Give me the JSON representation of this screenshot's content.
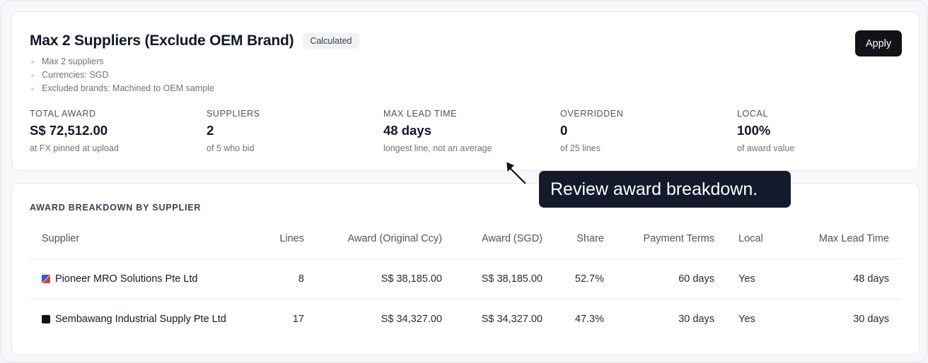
{
  "scenario": {
    "title": "Max 2 Suppliers (Exclude OEM Brand)",
    "badge": "Calculated",
    "apply_label": "Apply",
    "bullets": [
      "Max 2 suppliers",
      "Currencies: SGD",
      "Excluded brands: Machined to OEM sample"
    ]
  },
  "stats": [
    {
      "label": "TOTAL AWARD",
      "value": "S$ 72,512.00",
      "sub": "at FX pinned at upload"
    },
    {
      "label": "SUPPLIERS",
      "value": "2",
      "sub": "of 5 who bid"
    },
    {
      "label": "MAX LEAD TIME",
      "value": "48 days",
      "sub": "longest line, not an average"
    },
    {
      "label": "OVERRIDDEN",
      "value": "0",
      "sub": "of 25 lines"
    },
    {
      "label": "LOCAL",
      "value": "100%",
      "sub": "of award value"
    }
  ],
  "breakdown": {
    "title": "AWARD BREAKDOWN BY SUPPLIER",
    "columns": [
      "Supplier",
      "Lines",
      "Award (Original Ccy)",
      "Award (SGD)",
      "Share",
      "Payment Terms",
      "Local",
      "Max Lead Time"
    ],
    "rows": [
      {
        "supplier": "Pioneer MRO Solutions Pte Ltd",
        "icon": "pioneer-logo-icon",
        "lines": "8",
        "award_orig": "S$ 38,185.00",
        "award_sgd": "S$ 38,185.00",
        "share": "52.7%",
        "terms": "60 days",
        "local": "Yes",
        "lead": "48 days"
      },
      {
        "supplier": "Sembawang Industrial Supply Pte Ltd",
        "icon": "sembawang-logo-icon",
        "lines": "17",
        "award_orig": "S$ 34,327.00",
        "award_sgd": "S$ 34,327.00",
        "share": "47.3%",
        "terms": "30 days",
        "local": "Yes",
        "lead": "30 days"
      }
    ]
  },
  "tooltip": {
    "text": "Review award breakdown."
  },
  "colors": {
    "accent": "#111318",
    "tooltip_bg": "#141a2b",
    "card_bg": "#ffffff",
    "page_bg": "#f7f8fa"
  }
}
